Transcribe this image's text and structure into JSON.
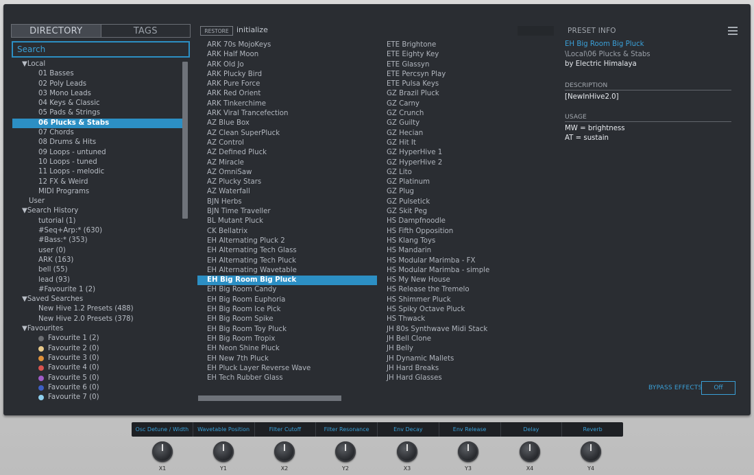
{
  "tabs": {
    "directory": "DIRECTORY",
    "tags": "TAGS"
  },
  "search": {
    "placeholder": "Search"
  },
  "tree": [
    {
      "label": "▼Local",
      "indent": 1
    },
    {
      "label": "01 Basses",
      "indent": 3
    },
    {
      "label": "02 Poly Leads",
      "indent": 3
    },
    {
      "label": "03 Mono Leads",
      "indent": 3
    },
    {
      "label": "04 Keys & Classic",
      "indent": 3
    },
    {
      "label": "05 Pads & Strings",
      "indent": 3
    },
    {
      "label": "06 Plucks & Stabs",
      "indent": 3,
      "selected": true
    },
    {
      "label": "07 Chords",
      "indent": 3
    },
    {
      "label": "08 Drums & Hits",
      "indent": 3
    },
    {
      "label": "09 Loops - untuned",
      "indent": 3
    },
    {
      "label": "10 Loops - tuned",
      "indent": 3
    },
    {
      "label": "11 Loops - melodic",
      "indent": 3
    },
    {
      "label": "12 FX & Weird",
      "indent": 3
    },
    {
      "label": "MIDI Programs",
      "indent": 3
    },
    {
      "label": "User",
      "indent": 2
    },
    {
      "label": "▼Search History",
      "indent": 1
    },
    {
      "label": "tutorial (1)",
      "indent": 3
    },
    {
      "label": "#Seq+Arp:* (630)",
      "indent": 3
    },
    {
      "label": "#Bass:* (353)",
      "indent": 3
    },
    {
      "label": "user (0)",
      "indent": 3
    },
    {
      "label": "ARK (163)",
      "indent": 3
    },
    {
      "label": "bell (55)",
      "indent": 3
    },
    {
      "label": "lead (93)",
      "indent": 3
    },
    {
      "label": "#Favourite 1 (2)",
      "indent": 3
    },
    {
      "label": "▼Saved Searches",
      "indent": 1
    },
    {
      "label": "New Hive 1.2 Presets (488)",
      "indent": 3
    },
    {
      "label": "New Hive 2.0 Presets (378)",
      "indent": 3
    },
    {
      "label": "▼Favourites",
      "indent": 1
    },
    {
      "label": "Favourite 1 (2)",
      "indent": 3,
      "dot": "#6d6f73"
    },
    {
      "label": "Favourite 2 (0)",
      "indent": 3,
      "dot": "#e8c98a"
    },
    {
      "label": "Favourite 3 (0)",
      "indent": 3,
      "dot": "#e0913a"
    },
    {
      "label": "Favourite 4 (0)",
      "indent": 3,
      "dot": "#d9534f"
    },
    {
      "label": "Favourite 5 (0)",
      "indent": 3,
      "dot": "#a05cc8"
    },
    {
      "label": "Favourite 6 (0)",
      "indent": 3,
      "dot": "#3d5fc4"
    },
    {
      "label": "Favourite 7 (0)",
      "indent": 3,
      "dot": "#8fd0ee"
    }
  ],
  "header": {
    "restore": "RESTORE",
    "preset_name": "initialize"
  },
  "presets_col1": [
    "ARK 70s MojoKeys",
    "ARK Half Moon",
    "ARK Old Jo",
    "ARK Plucky Bird",
    "ARK Pure Force",
    "ARK Red Orient",
    "ARK Tinkerchime",
    "ARK Viral Trancefection",
    "AZ Blue Box",
    "AZ Clean SuperPluck",
    "AZ Control",
    "AZ Defined Pluck",
    "AZ Miracle",
    "AZ OmniSaw",
    "AZ Plucky Stars",
    "AZ Waterfall",
    "BJN Herbs",
    "BJN Time Traveller",
    "BL Mutant Pluck",
    "CK Bellatrix",
    "EH Alternating Pluck 2",
    "EH Alternating Tech Glass",
    "EH Alternating Tech Pluck",
    "EH Alternating Wavetable",
    "EH Big Room Big Pluck",
    "EH Big Room Candy",
    "EH Big Room Euphoria",
    "EH Big Room Ice Pick",
    "EH Big Room Spike",
    "EH Big Room Toy Pluck",
    "EH Big Room Tropix",
    "EH Neon Shine Pluck",
    "EH New 7th Pluck",
    "EH Pluck Layer Reverse Wave",
    "EH Tech Rubber Glass"
  ],
  "selected_preset": "EH Big Room Big Pluck",
  "presets_col2": [
    "ETE Brightone",
    "ETE Eighty Key",
    "ETE Glassyn",
    "ETE Percsyn Play",
    "ETE Pulsa Keys",
    "GZ Brazil Pluck",
    "GZ Carny",
    "GZ Crunch",
    "GZ Guilty",
    "GZ Hecian",
    "GZ Hit It",
    "GZ HyperHive 1",
    "GZ HyperHive 2",
    "GZ Lito",
    "GZ Platinum",
    "GZ Plug",
    "GZ Pulsetick",
    "GZ Skit Peg",
    "HS Dampfnoodle",
    "HS Fifth Opposition",
    "HS Klang Toys",
    "HS Mandarin",
    "HS Modular Marimba - FX",
    "HS Modular Marimba - simple",
    "HS My New House",
    "HS Release the Tremelo",
    "HS Shimmer Pluck",
    "HS Spiky Octave Pluck",
    "HS Thwack",
    "JH 80s Synthwave Midi Stack",
    "JH Bell Clone",
    "JH Belly",
    "JH Dynamic Mallets",
    "JH Hard Breaks",
    "JH Hard Glasses"
  ],
  "info": {
    "heading": "PRESET INFO",
    "title": "EH Big Room Big Pluck",
    "path": "\\Local\\06 Plucks & Stabs",
    "author": "by Electric Himalaya",
    "description_label": "DESCRIPTION",
    "description": "[NewInHive2.0]",
    "usage_label": "USAGE",
    "usage_1": "MW = brightness",
    "usage_2": "AT = sustain"
  },
  "bypass": {
    "label": "BYPASS EFFECTS",
    "value": "Off"
  },
  "macros": [
    {
      "name": "Osc Detune / Width",
      "knob": "X1"
    },
    {
      "name": "Wavetable Position",
      "knob": "Y1"
    },
    {
      "name": "Filter Cutoff",
      "knob": "X2"
    },
    {
      "name": "Filter Resonance",
      "knob": "Y2"
    },
    {
      "name": "Env Decay",
      "knob": "X3"
    },
    {
      "name": "Env Release",
      "knob": "Y3"
    },
    {
      "name": "Delay",
      "knob": "X4"
    },
    {
      "name": "Reverb",
      "knob": "Y4"
    }
  ],
  "colors": {
    "accent": "#2c8fc4",
    "panel": "#2a2d32"
  }
}
